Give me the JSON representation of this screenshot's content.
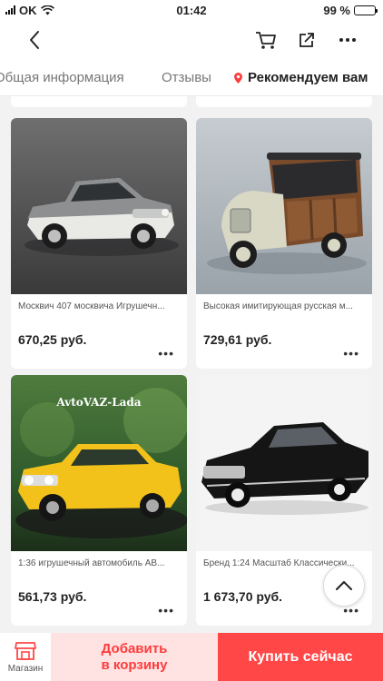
{
  "status_bar": {
    "carrier": "OK",
    "time": "01:42",
    "battery": "99 %",
    "battery_level": 0.99
  },
  "nav": {
    "back_icon": "chevron-left-icon",
    "cart_icon": "cart-icon",
    "share_icon": "share-icon",
    "more_icon": "more-icon"
  },
  "tabs": {
    "general": "Общая информация",
    "reviews": "Отзывы",
    "recommended": "Рекомендуем вам"
  },
  "colors": {
    "accent": "#ff4747",
    "accent_light": "#ffe2e2",
    "location_pin": "#ff3b3b"
  },
  "products": [
    {
      "title": "Москвич 407 москвича Игрушечн...",
      "price": "670,25 руб.",
      "more": "•••",
      "image": "gray-white-sedan-model"
    },
    {
      "title": "Высокая имитирующая русская м...",
      "price": "729,61 руб.",
      "more": "•••",
      "image": "wood-panel-wagon-model"
    },
    {
      "title": "1:36 игрушечный автомобиль АВ...",
      "price": "561,73 руб.",
      "more": "•••",
      "image": "yellow-lada-model",
      "image_caption": "AvtoVAZ-Lada"
    },
    {
      "title": "Бренд 1:24 Масштаб Классически...",
      "price": "1 673,70 руб.",
      "more": "•••",
      "image": "black-volga-model"
    }
  ],
  "bottom_bar": {
    "shop_label": "Магазин",
    "add_to_cart": "Добавить\nв корзину",
    "buy_now": "Купить сейчас"
  }
}
